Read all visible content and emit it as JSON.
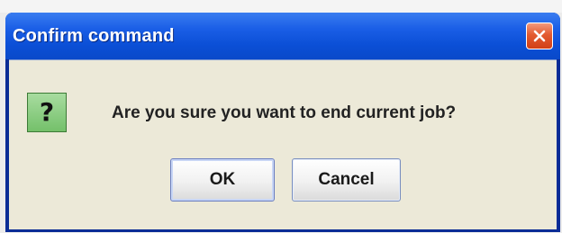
{
  "dialog": {
    "title": "Confirm command",
    "icon": "question-icon",
    "icon_glyph": "?",
    "message": "Are you sure you want to end current job?",
    "buttons": {
      "ok_label": "OK",
      "cancel_label": "Cancel"
    }
  },
  "colors": {
    "titlebar": "#0b4fd6",
    "close_button": "#e35b30",
    "dialog_body": "#ece9d8",
    "question_icon": "#74c06a"
  }
}
